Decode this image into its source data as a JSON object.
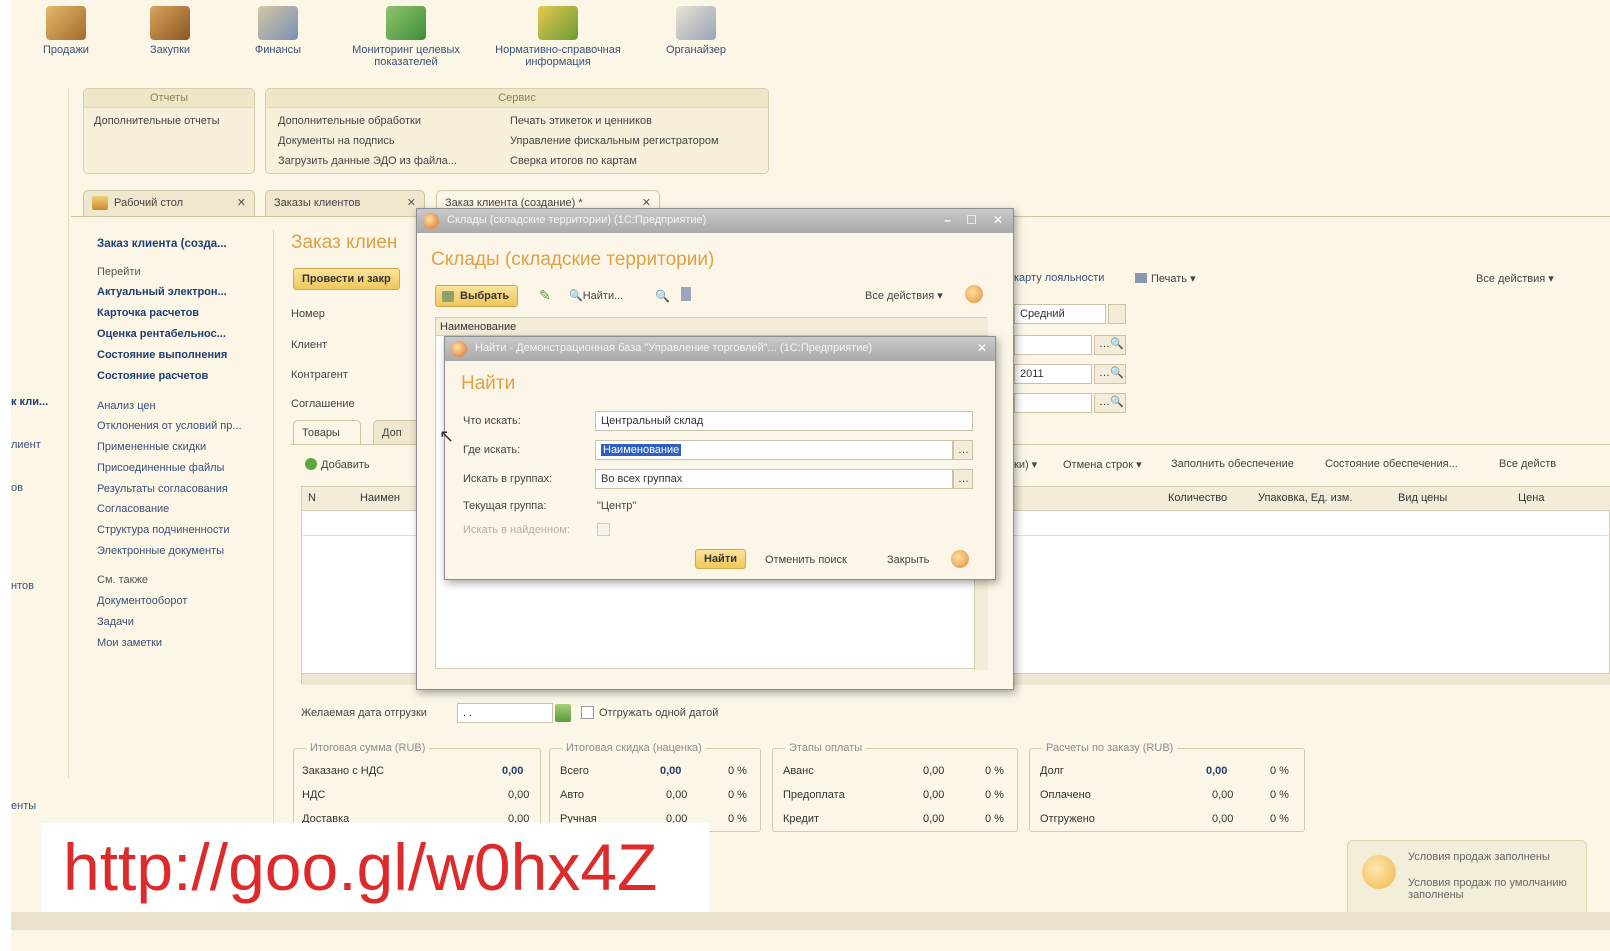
{
  "sections": [
    {
      "label": "Продажи",
      "icon": "sales-icon"
    },
    {
      "label": "Закупки",
      "icon": "purchases-icon"
    },
    {
      "label": "Финансы",
      "icon": "finance-icon"
    },
    {
      "label": "Мониторинг целевых показателей",
      "icon": "monitoring-icon"
    },
    {
      "label": "Нормативно-справочная информация",
      "icon": "reference-icon"
    },
    {
      "label": "Органайзер",
      "icon": "organizer-icon"
    }
  ],
  "reports_panel": {
    "title": "Отчеты",
    "item": "Дополнительные отчеты"
  },
  "service_panel": {
    "title": "Сервис",
    "col1": [
      "Дополнительные обработки",
      "Документы на подпись",
      "Загрузить данные ЭДО из файла..."
    ],
    "col2": [
      "Печать этикеток и ценников",
      "Управление фискальным регистратором",
      "Сверка итогов по картам"
    ]
  },
  "tabs": [
    "Рабочий стол",
    "Заказы клиентов",
    "Заказ клиента (создание) *"
  ],
  "left_nav": {
    "title": "Заказ клиента (созда...",
    "goto": "Перейти",
    "bold_items": [
      "Актуальный электрон...",
      "Карточка расчетов",
      "Оценка рентабельнос...",
      "Состояние выполнения",
      "Состояние расчетов"
    ],
    "items": [
      "Анализ цен",
      "Отклонения от условий пр...",
      "Примененные скидки",
      "Присоединенные файлы",
      "Результаты согласования",
      "Согласование",
      "Структура подчиненности",
      "Электронные документы"
    ],
    "see_also": "См. также",
    "see_also_items": [
      "Документооборот",
      "Задачи",
      "Мои заметки"
    ]
  },
  "form": {
    "title": "Заказ клиен",
    "post_button": "Провести и закр",
    "labels": [
      "Номер",
      "Клиент",
      "Контрагент",
      "Соглашение"
    ],
    "inner_tabs": [
      "Товары",
      "Доп"
    ],
    "add_button": "Добавить",
    "col_n": "N",
    "col_name": "Наимен",
    "right_links": [
      "карту лояльности",
      "Печать",
      "Все действия"
    ],
    "priority_value": "Средний",
    "date_value": "2011",
    "table_links": [
      "Отмена строк",
      "Заполнить обеспечение",
      "Состояние обеспечения...",
      "Все действ"
    ],
    "table_cols": [
      "Количество",
      "Упаковка, Ед. изм.",
      "Вид цены",
      "Цена"
    ],
    "ship_date_label": "Желаемая дата отгрузки",
    "ship_date_value": "  .  .",
    "ship_one_date": "Отгружать одной датой"
  },
  "summary": {
    "total": {
      "caption": "Итоговая сумма (RUB)",
      "rows": [
        [
          "Заказано с НДС",
          "0,00"
        ],
        [
          "НДС",
          "0,00"
        ],
        [
          "Доставка",
          "0,00"
        ]
      ]
    },
    "discount": {
      "caption": "Итоговая скидка (наценка)",
      "rows": [
        [
          "Всего",
          "0,00",
          "0 %"
        ],
        [
          "Авто",
          "0,00",
          "0 %"
        ],
        [
          "Ручная",
          "0,00",
          "0 %"
        ]
      ]
    },
    "payment": {
      "caption": "Этапы оплаты",
      "rows": [
        [
          "Аванс",
          "0,00",
          "0 %"
        ],
        [
          "Предоплата",
          "0,00",
          "0 %"
        ],
        [
          "Кредит",
          "0,00",
          "0 %"
        ]
      ]
    },
    "calc": {
      "caption": "Расчеты по заказу (RUB)",
      "rows": [
        [
          "Долг",
          "0,00",
          "0 %"
        ],
        [
          "Оплачено",
          "0,00",
          "0 %"
        ],
        [
          "Отгружено",
          "0,00",
          "0 %"
        ]
      ]
    }
  },
  "warehouse_dialog": {
    "window_title": "Склады (складские территории) (1С:Предприятие)",
    "heading": "Склады (складские территории)",
    "select_button": "Выбрать",
    "find_button": "Найти...",
    "all_actions": "Все действия",
    "col_name": "Наименование"
  },
  "find_dialog": {
    "window_title": "Найти - Демонстрационная база \"Управление торговлей\"... (1С:Предприятие)",
    "heading": "Найти",
    "what_label": "Что искать:",
    "what_value": "Центральный склад",
    "where_label": "Где искать:",
    "where_value": "Наименование",
    "groups_label": "Искать в группах:",
    "groups_value": "Во всех группах",
    "current_label": "Текущая группа:",
    "current_value": "\"Центр\"",
    "in_found_label": "Искать в найденном:",
    "find_button": "Найти",
    "cancel_button": "Отменить поиск",
    "close_button": "Закрыть"
  },
  "left_edge_bits": [
    "к кли...",
    "лиент",
    "ов",
    "нтов",
    "енты"
  ],
  "notification": {
    "title": "Условия продаж заполнены",
    "text": "Условия продаж по умолчанию заполнены"
  },
  "watermark_url": "http://goo.gl/w0hx4Z"
}
